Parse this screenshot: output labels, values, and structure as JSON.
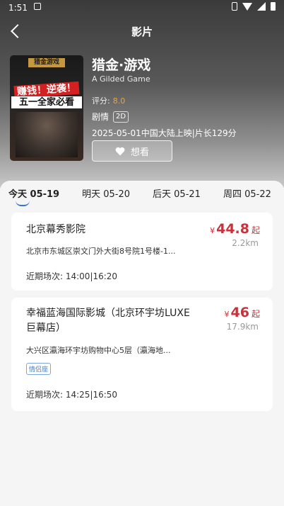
{
  "status": {
    "time": "1:51"
  },
  "nav": {
    "title": "影片"
  },
  "poster": {
    "title_text": "猎金游戏",
    "line1": "赚钱！逆袭！",
    "line2": "五一全家必看"
  },
  "movie": {
    "title": "猎金·游戏",
    "english_title": "A Gilded Game",
    "rating_label": "评分:",
    "rating_value": "8.0",
    "genre": "剧情",
    "format": "2D",
    "release_info": "2025-05-01中国大陆上映|片长129分",
    "want_label": "想看"
  },
  "date_tabs": [
    {
      "label": "今天 05-19",
      "active": true
    },
    {
      "label": "明天 05-20",
      "active": false
    },
    {
      "label": "后天 05-21",
      "active": false
    },
    {
      "label": "周四 05-22",
      "active": false
    }
  ],
  "cinemas": [
    {
      "name": "北京幕秀影院",
      "price_symbol": "¥",
      "price": "44.8",
      "price_suffix": "起",
      "distance": "2.2km",
      "address": "北京市东城区崇文门外大街8号院1号楼-1...",
      "schedule": "近期场次: 14:00|16:20"
    },
    {
      "name_line1": "幸福蓝海国际影城（北京环宇坊LUXE",
      "name_line2": "巨幕店）",
      "price_symbol": "¥",
      "price": "46",
      "price_suffix": "起",
      "distance": "17.9km",
      "address": "大兴区瀛海环宇坊购物中心5层（瀛海地...",
      "tag": "情侣座",
      "schedule": "近期场次: 14:25|16:50"
    }
  ],
  "colors": {
    "accent_price": "#c8323c",
    "rating": "#f0a23a",
    "tab_indicator": "#3a73d6"
  }
}
